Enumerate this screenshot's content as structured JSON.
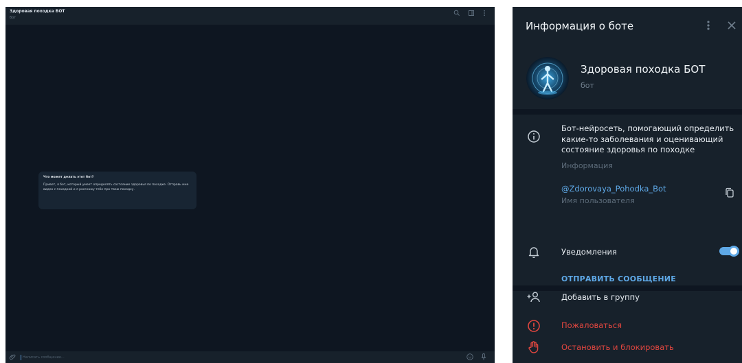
{
  "chat": {
    "title": "Здоровая походка БОТ",
    "subtitle": "бот",
    "bot_card": {
      "title": "Что может делать этот бот?",
      "text": "Привет, я бот, который умеет определять состояние здоровья по походке. Отправь мне видео с походкой и я расскажу тебе про твою походку."
    },
    "composer_placeholder": "Написать сообщение..."
  },
  "info_panel": {
    "title": "Информация о боте",
    "bot_name": "Здоровая походка БОТ",
    "bot_type": "бот",
    "description": "Бот-нейросеть, помогающий определить какие-то заболевания и оценивающий состояние здоровья по походке",
    "description_caption": "Информация",
    "username": "@Zdorovaya_Pohodka_Bot",
    "username_caption": "Имя пользователя",
    "notifications_label": "Уведомления",
    "notifications_enabled": true,
    "send_message": "ОТПРАВИТЬ СООБЩЕНИЕ",
    "add_to_group": "Добавить в группу",
    "report": "Пожаловаться",
    "block": "Остановить и блокировать"
  },
  "icons": {
    "search": "search-icon",
    "sidebar": "sidebar-toggle-icon",
    "menu": "more-vertical-icon",
    "attach": "paperclip-icon",
    "emoji": "emoji-icon",
    "mic": "microphone-icon",
    "close": "close-icon",
    "info": "info-icon",
    "copy": "copy-icon",
    "bell": "bell-icon",
    "add_user": "add-user-icon",
    "report": "warning-icon",
    "block": "hand-stop-icon"
  },
  "colors": {
    "chat_bg": "#0e1621",
    "panel_bg": "#17212b",
    "accent": "#5ea8e6",
    "danger": "#e0463f",
    "text": "#e6ebf0",
    "muted": "#5c6b79"
  }
}
